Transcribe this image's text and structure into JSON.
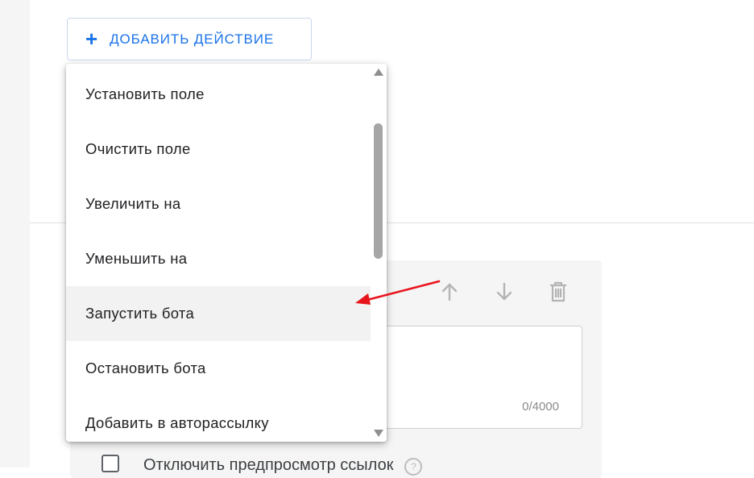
{
  "toolbar": {
    "add_action_label": "ДОБАВИТЬ ДЕЙСТВИЕ",
    "add_icon": "plus-icon",
    "accent_color": "#1a73e8"
  },
  "action_menu": {
    "items": [
      {
        "label": "Установить поле"
      },
      {
        "label": "Очистить поле"
      },
      {
        "label": "Увеличить на"
      },
      {
        "label": "Уменьшить на"
      },
      {
        "label": "Запустить бота",
        "highlighted": true
      },
      {
        "label": "Остановить бота"
      },
      {
        "label": "Добавить в авторассылку"
      }
    ]
  },
  "card": {
    "icons": [
      "arrow-up-icon",
      "arrow-down-icon",
      "trash-icon"
    ],
    "counter": "0/4000"
  },
  "options": {
    "disable_link_preview_label": "Отключить предпросмотр ссылок",
    "help_icon": "help-icon"
  },
  "annotation": {
    "arrow_color": "#e8141c",
    "arrow_target": "Запустить бота"
  }
}
